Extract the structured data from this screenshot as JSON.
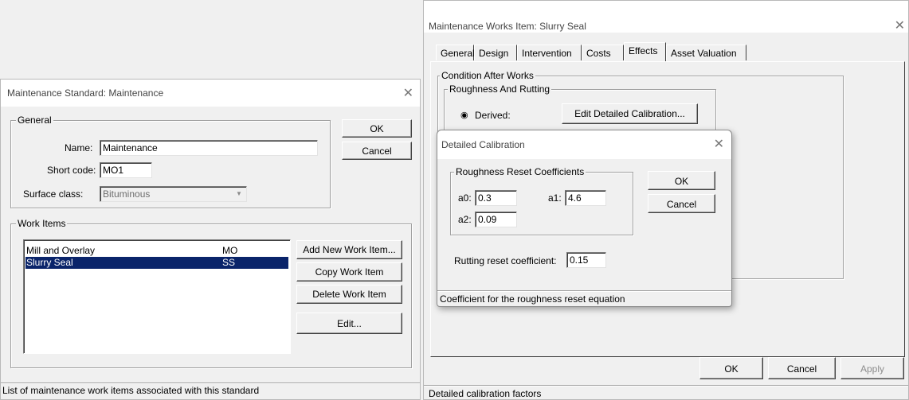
{
  "dialog_left": {
    "title": "Maintenance Standard: Maintenance",
    "general_label": "General",
    "name_label": "Name:",
    "name_value": "Maintenance",
    "shortcode_label": "Short code:",
    "shortcode_value": "MO1",
    "surface_label": "Surface class:",
    "surface_value": "Bituminous",
    "ok_label": "OK",
    "cancel_label": "Cancel",
    "workitems_label": "Work Items",
    "work_items": [
      {
        "name": "Mill and Overlay",
        "code": "MO"
      },
      {
        "name": "Slurry Seal",
        "code": "SS"
      }
    ],
    "add_label": "Add New Work Item...",
    "copy_label": "Copy Work Item",
    "delete_label": "Delete Work Item",
    "edit_label": "Edit...",
    "status": "List of maintenance work items associated with this standard"
  },
  "dialog_right": {
    "title": "Maintenance Works Item: Slurry Seal",
    "tabs": [
      "General",
      "Design",
      "Intervention",
      "Costs",
      "Effects",
      "Asset Valuation"
    ],
    "active_tab": "Effects",
    "condition_label": "Condition After Works",
    "roughness_label": "Roughness And Rutting",
    "derived_label": "Derived:",
    "edit_calib_label": "Edit Detailed Calibration...",
    "ok_label": "OK",
    "cancel_label": "Cancel",
    "apply_label": "Apply",
    "status": "Detailed calibration factors"
  },
  "dialog_calib": {
    "title": "Detailed Calibration",
    "coeff_group_label": "Roughness Reset Coefficients",
    "a0_label": "a0:",
    "a0_value": "0.3",
    "a1_label": "a1:",
    "a1_value": "4.6",
    "a2_label": "a2:",
    "a2_value": "0.09",
    "ok_label": "OK",
    "cancel_label": "Cancel",
    "rutting_label": "Rutting reset coefficient:",
    "rutting_value": "0.15",
    "status": "Coefficient for the roughness reset equation"
  },
  "colors": {
    "selection": "#0a246a",
    "dialog_bg": "#f0f0f0",
    "title_bg": "#ffffff"
  }
}
